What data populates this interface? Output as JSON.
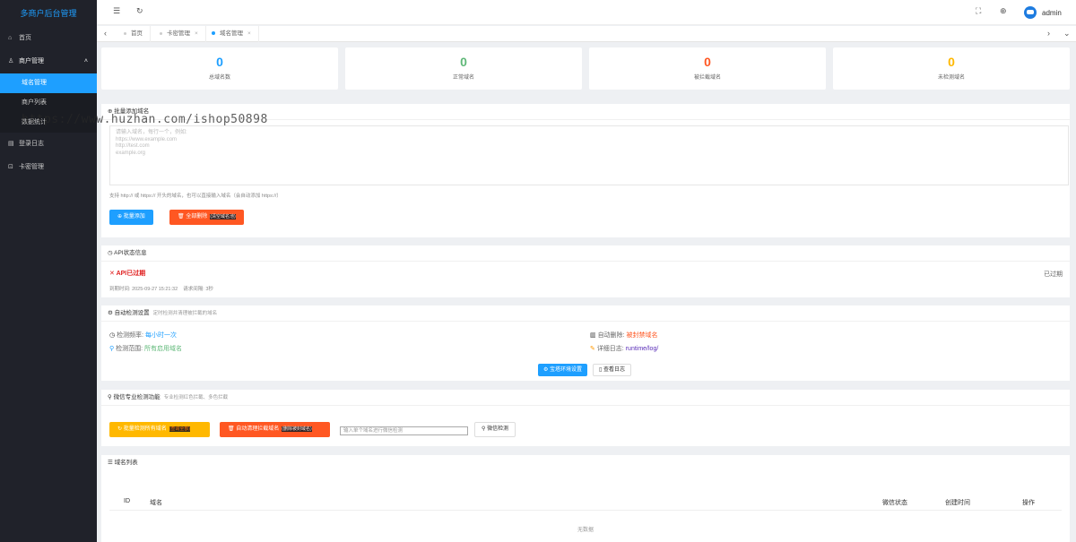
{
  "sidebar": {
    "logo": "多商户后台管理",
    "items": [
      {
        "label": "首页"
      },
      {
        "label": "商户管理"
      },
      {
        "label": "域名管理"
      },
      {
        "label": "商户列表"
      },
      {
        "label": "数据统计"
      },
      {
        "label": "登录日志"
      },
      {
        "label": "卡密管理"
      }
    ]
  },
  "header": {
    "user": "admin"
  },
  "tabs": [
    {
      "label": "首页"
    },
    {
      "label": "卡密管理"
    },
    {
      "label": "域名管理"
    }
  ],
  "stats": [
    {
      "value": "0",
      "label": "总域名数",
      "color": "#1e9fff"
    },
    {
      "value": "0",
      "label": "正常域名",
      "color": "#5fb878"
    },
    {
      "value": "0",
      "label": "被拦截域名",
      "color": "#ff5722"
    },
    {
      "value": "0",
      "label": "未检测域名",
      "color": "#ffb800"
    }
  ],
  "batch": {
    "title": "批量添加域名",
    "placeholder": "请输入域名，每行一个，例如:\nhttps://www.example.com\nhttp://test.com\nexample.org",
    "hint": "支持 http:// 或 https:// 开头的域名，也可以直接输入域名（会自动添加 https://）",
    "add_btn": "批量添加",
    "del_btn": "全部删除",
    "del_sub": "(清空域名池)"
  },
  "api": {
    "title": "API状态信息",
    "status": "API已过期",
    "expire_label": "到期时间:",
    "expire_time": "2025-09-27 15:21:32",
    "interval_label": "请求间隔:",
    "interval": "3秒",
    "right": "已过期"
  },
  "auto": {
    "title": "自动检测设置",
    "desc": "定时检测并清理被拦截的域名",
    "freq_label": "检测频率:",
    "freq": "每小时一次",
    "range_label": "检测范围:",
    "range": "所有启用域名",
    "del_label": "自动删除:",
    "del": "被封禁域名",
    "log_label": "详细日志:",
    "log": "runtime/log/",
    "btn_cron": "宝塔环境设置",
    "btn_log": "查看日志"
  },
  "wechat": {
    "title": "微信专业检测功能",
    "desc": "专业检测红色拦截、多色拦截",
    "btn1": "批量检测所有域名",
    "btn1_sub": "(查询全部)",
    "btn2": "自动清理拦截域名",
    "btn2_sub": "(删除被封域名)",
    "input_ph": "输入单个域名进行微信检测",
    "btn3": "微信检测"
  },
  "list": {
    "title": "域名列表",
    "cols": [
      "ID",
      "域名",
      "微信状态",
      "创建时间",
      "操作"
    ],
    "empty": "无数据"
  },
  "watermark": "https://www.huzhan.com/ishop50898"
}
